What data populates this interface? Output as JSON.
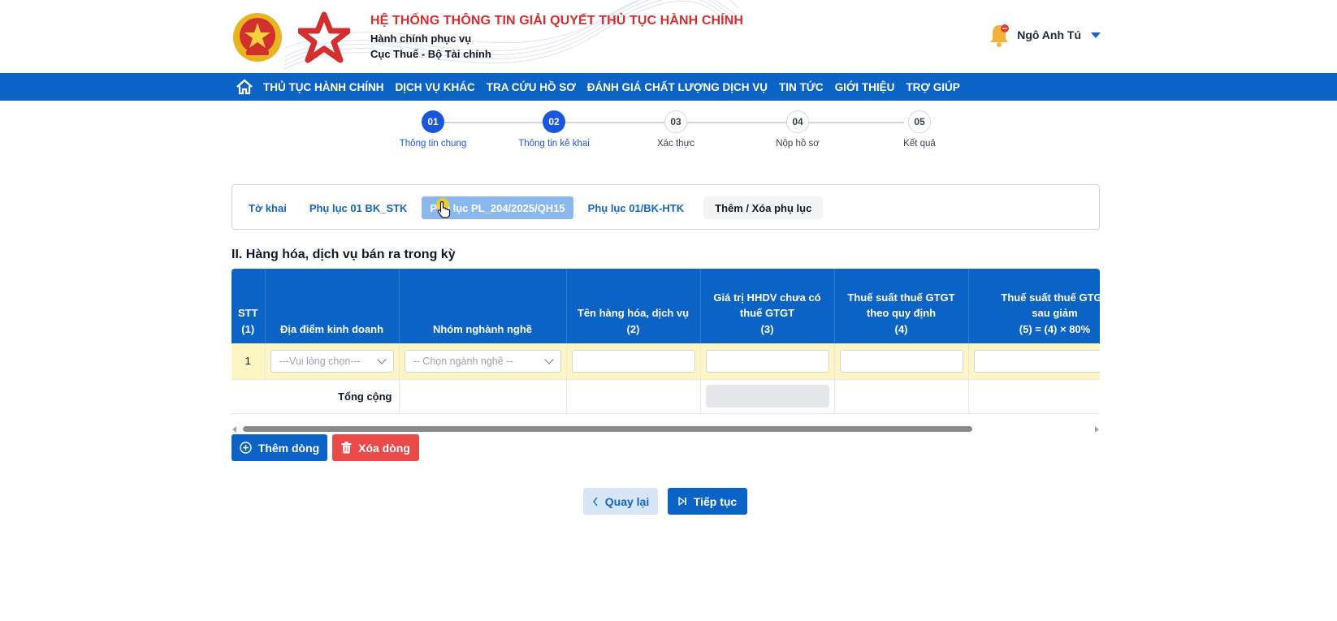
{
  "header": {
    "system_title": "HỆ THỐNG THÔNG TIN GIẢI QUYẾT THỦ TỤC HÀNH CHÍNH",
    "subtitle_1": "Hành chính phục vụ",
    "subtitle_2": "Cục Thuế - Bộ Tài chính",
    "user_name": "Ngô Anh Tú",
    "icons": {
      "emblem": "national-emblem-icon",
      "logo": "star-logo-icon",
      "bell": "bell-icon",
      "menu": "caret-down-icon"
    }
  },
  "nav": {
    "home_icon": "home-icon",
    "items": [
      "THỦ TỤC HÀNH CHÍNH",
      "DỊCH VỤ KHÁC",
      "TRA CỨU HỒ SƠ",
      "ĐÁNH GIÁ CHẤT LƯỢNG DỊCH VỤ",
      "TIN TỨC",
      "GIỚI THIỆU",
      "TRỢ GIÚP"
    ]
  },
  "stepper": {
    "steps": [
      {
        "number": "01",
        "label": "Thông tin chung",
        "state": "done"
      },
      {
        "number": "02",
        "label": "Thông tin kê khai",
        "state": "done"
      },
      {
        "number": "03",
        "label": "Xác thực",
        "state": "todo"
      },
      {
        "number": "04",
        "label": "Nộp hồ sơ",
        "state": "todo"
      },
      {
        "number": "05",
        "label": "Kết quả",
        "state": "todo"
      }
    ]
  },
  "tabs": {
    "items": [
      "Tờ khai",
      "Phụ lục 01 BK_STK",
      "Phụ lục PL_204/2025/QH15",
      "Phụ lục 01/BK-HTK"
    ],
    "active_index": 2,
    "manage_label": "Thêm / Xóa phụ lục"
  },
  "section": {
    "title": "II. Hàng hóa, dịch vụ bán ra trong kỳ"
  },
  "table": {
    "headers": [
      [
        "STT",
        "(1)"
      ],
      [
        "Địa điểm kinh doanh"
      ],
      [
        "Nhóm nghành nghề"
      ],
      [
        "Tên hàng hóa, dịch vụ",
        "(2)"
      ],
      [
        "Giá trị HHDV chưa có",
        "thuế GTGT",
        "(3)"
      ],
      [
        "Thuế suất thuế GTGT",
        "theo quy định",
        "(4)"
      ],
      [
        "Thuế suất thuế GTGT",
        "sau giảm",
        "(5) = (4) × 80%"
      ]
    ],
    "row": {
      "stt": "1",
      "location_placeholder": "---Vui lòng chọn---",
      "industry_placeholder": "-- Chọn ngành nghề --"
    },
    "total_label": "Tổng cộng"
  },
  "actions": {
    "add_row": "Thêm dòng",
    "delete_row": "Xóa dòng",
    "back": "Quay lại",
    "next": "Tiếp tục"
  },
  "colors": {
    "primary": "#0b63c5",
    "title_red": "#d32f2f",
    "danger": "#e94a4a",
    "row_highlight": "#fdf6c3",
    "tab_active": "#8ab8ec"
  }
}
